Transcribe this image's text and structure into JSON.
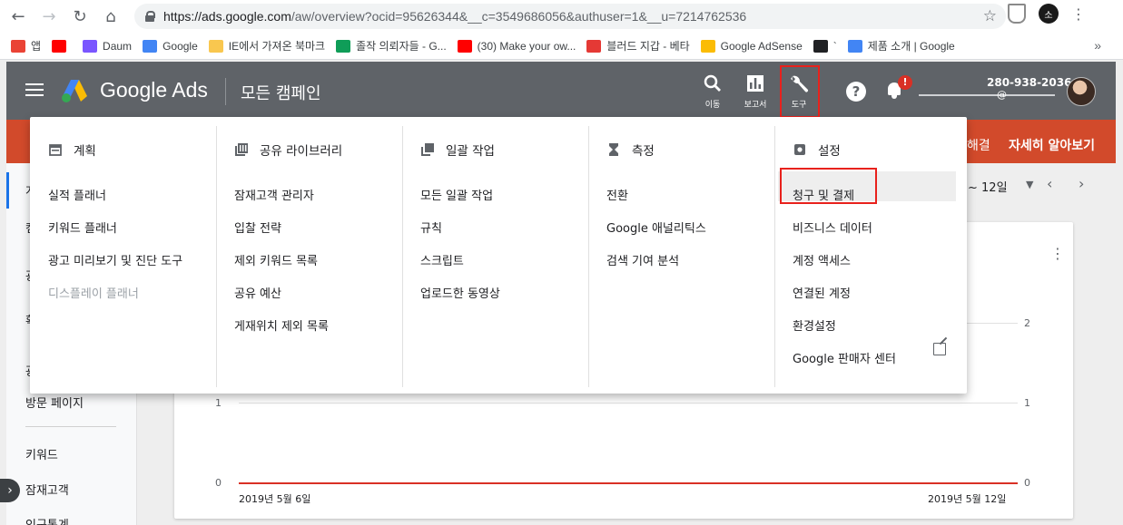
{
  "browser": {
    "url_base": "https://ads.google.com",
    "url_path": "/aw/overview?ocid=95626344&__c=3549686056&authuser=1&__u=7214762536",
    "profile_initial": "소"
  },
  "bookmarks": [
    {
      "label": "앱",
      "icon": "apps-grid-icon",
      "color": "#ea4335"
    },
    {
      "label": "",
      "icon": "youtube-icon",
      "color": "#ff0000"
    },
    {
      "label": "Daum",
      "icon": "daum-icon",
      "color": "#7a56ff"
    },
    {
      "label": "Google",
      "icon": "google-g-icon",
      "color": "#4285f4"
    },
    {
      "label": "IE에서 가져온 북마크",
      "icon": "folder-icon",
      "color": "#f9c74f"
    },
    {
      "label": "졸작 의뢰자들 - G...",
      "icon": "sheets-icon",
      "color": "#0f9d58"
    },
    {
      "label": "(30) Make your ow...",
      "icon": "youtube-icon",
      "color": "#ff0000"
    },
    {
      "label": "블러드 지갑 - 베타",
      "icon": "blood-wallet-icon",
      "color": "#e53935"
    },
    {
      "label": "Google AdSense",
      "icon": "adsense-icon",
      "color": "#fbbc04"
    },
    {
      "label": "`",
      "icon": "dots-icon",
      "color": "#202124"
    },
    {
      "label": "제품 소개 | Google",
      "icon": "google-g-icon",
      "color": "#4285f4"
    }
  ],
  "header": {
    "brand": "Google Ads",
    "page_title": "모든 캠페인",
    "buttons": {
      "search": "이동",
      "reports": "보고서",
      "tools": "도구"
    },
    "badge": "!",
    "account_id": "280-938-2036",
    "account_email": "@"
  },
  "banner": {
    "text_a": "해결",
    "text_b": "자세히 알아보기"
  },
  "leftnav": {
    "items": [
      "개",
      "캠",
      "광",
      "확",
      "광",
      "방문 페이지",
      "키워드",
      "잠재고객",
      "인구통계"
    ]
  },
  "menu": {
    "columns": [
      {
        "title": "계획",
        "icon": "calendar-icon",
        "items": [
          {
            "label": "실적 플래너",
            "disabled": false
          },
          {
            "label": "키워드 플래너",
            "disabled": false
          },
          {
            "label": "광고 미리보기 및 진단 도구",
            "disabled": false
          },
          {
            "label": "디스플레이 플래너",
            "disabled": true
          }
        ]
      },
      {
        "title": "공유 라이브러리",
        "icon": "library-icon",
        "items": [
          {
            "label": "잠재고객 관리자",
            "disabled": false
          },
          {
            "label": "입찰 전략",
            "disabled": false
          },
          {
            "label": "제외 키워드 목록",
            "disabled": false
          },
          {
            "label": "공유 예산",
            "disabled": false
          },
          {
            "label": "게재위치 제외 목록",
            "disabled": false
          }
        ]
      },
      {
        "title": "일괄 작업",
        "icon": "copy-icon",
        "items": [
          {
            "label": "모든 일괄 작업",
            "disabled": false
          },
          {
            "label": "규칙",
            "disabled": false
          },
          {
            "label": "스크립트",
            "disabled": false
          },
          {
            "label": "업로드한 동영상",
            "disabled": false
          }
        ]
      },
      {
        "title": "측정",
        "icon": "hourglass-icon",
        "items": [
          {
            "label": "전환",
            "disabled": false
          },
          {
            "label": "Google 애널리틱스",
            "disabled": false
          },
          {
            "label": "검색 기여 분석",
            "disabled": false
          }
        ]
      },
      {
        "title": "설정",
        "icon": "settings-icon",
        "items": [
          {
            "label": "청구 및 결제",
            "disabled": false,
            "highlighted": true
          },
          {
            "label": "비즈니스 데이터",
            "disabled": false
          },
          {
            "label": "계정 액세스",
            "disabled": false
          },
          {
            "label": "연결된 계정",
            "disabled": false
          },
          {
            "label": "환경설정",
            "disabled": false
          },
          {
            "label": "Google 판매자 센터",
            "disabled": false,
            "external": true
          }
        ]
      }
    ]
  },
  "date_range": {
    "label": "~ 12일"
  },
  "chart": {
    "y_left": [
      "1",
      "0"
    ],
    "y_right": [
      "2",
      "1",
      "0"
    ],
    "x_start": "2019년 5월 6일",
    "x_end": "2019년 5월 12일"
  },
  "colors": {
    "header_bg": "#5f6368",
    "banner_bg": "#d24a2b",
    "highlight_border": "#e8211c",
    "series_line": "#d93025"
  }
}
